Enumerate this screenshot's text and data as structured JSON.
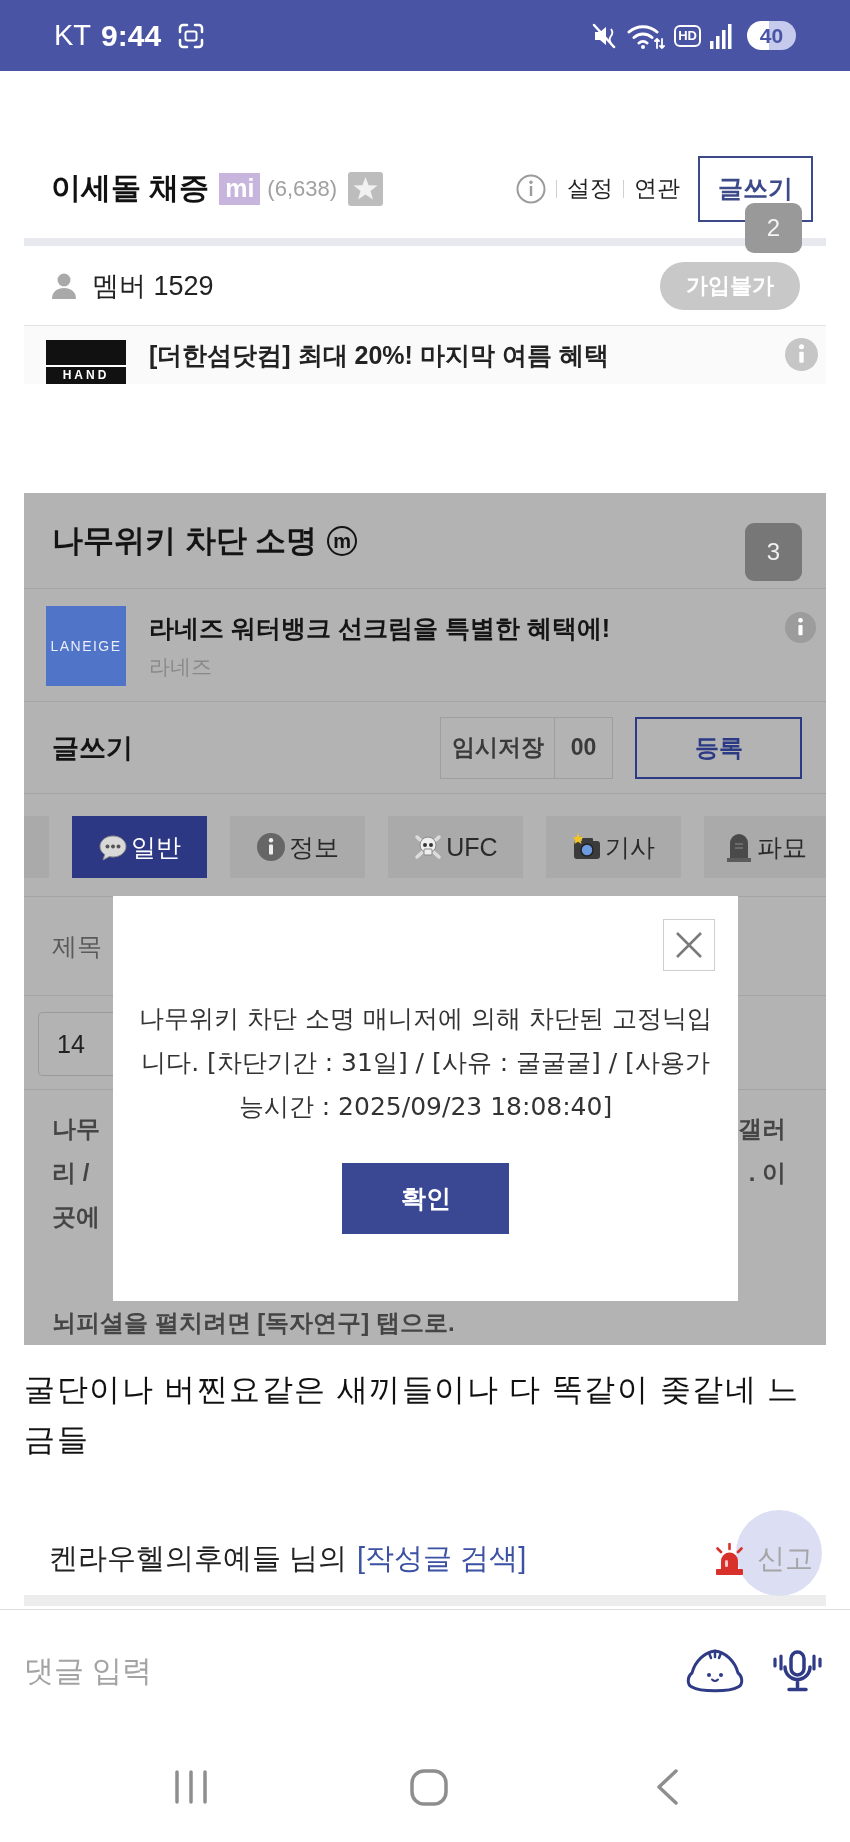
{
  "status_bar": {
    "carrier": "KT",
    "time": "9:44",
    "hd_label": "HD",
    "battery": "40"
  },
  "cafe_header": {
    "title": "이세돌 채증",
    "level_badge": "mi",
    "count": "(6,638)",
    "links": [
      "설정",
      "연관"
    ],
    "write_button": "글쓰기",
    "overlay_number": "2"
  },
  "member_row": {
    "label": "멤버 1529",
    "join_button": {
      "label": "가입불가",
      "disabled": true
    }
  },
  "top_ad": {
    "logo": "HAND",
    "headline": "[더한섬닷컴] 최대 20%! 마지막 여름 혜택"
  },
  "embedded_page": {
    "title": "나무위키 차단 소명",
    "title_badge": "m",
    "overlay_number": "3",
    "ad": {
      "logo": "LANEIGE",
      "headline": "라네즈 워터뱅크 선크림을 특별한 혜택에!",
      "advertiser": "라네즈"
    },
    "compose": {
      "heading": "글쓰기",
      "draft_button": "임시저장",
      "draft_count": "00",
      "submit_button": "등록"
    },
    "tabs": [
      {
        "kind": "partial",
        "selected": false
      },
      {
        "kind": "speech",
        "label": "일반",
        "selected": true
      },
      {
        "kind": "info",
        "label": "정보",
        "selected": false
      },
      {
        "kind": "skull",
        "label": "UFC",
        "selected": false
      },
      {
        "kind": "camera",
        "label": "기사",
        "selected": false
      },
      {
        "kind": "tombstone",
        "label": "파묘",
        "selected": false
      }
    ],
    "subject_label": "제목",
    "font_size_field": {
      "value": "14"
    },
    "body_lines": [
      {
        "left": "나무",
        "right": "갤러"
      },
      {
        "left": "리 /",
        "right": ". 이"
      },
      {
        "left": "곳에"
      }
    ],
    "last_line": "뇌피셜을 펼치려면 [독자연구] 탭으로.",
    "dialog": {
      "message": "나무위키 차단 소명 매니저에 의해 차단된 고정닉입니다. [차단기간 : 31일] / [사유 : 굴굴굴] / [사용가능시간 : 2025/09/23 18:08:40]",
      "confirm_button": "확인"
    }
  },
  "post": {
    "body": "굴단이나 버찐요같은 새끼들이나 다 똑같이 좆같네 느금들",
    "author": "켄라우헬의후예들 님의",
    "search_link": "[작성글 검색]",
    "report_button": "신고"
  },
  "comment_bar": {
    "placeholder": "댓글 입력"
  }
}
